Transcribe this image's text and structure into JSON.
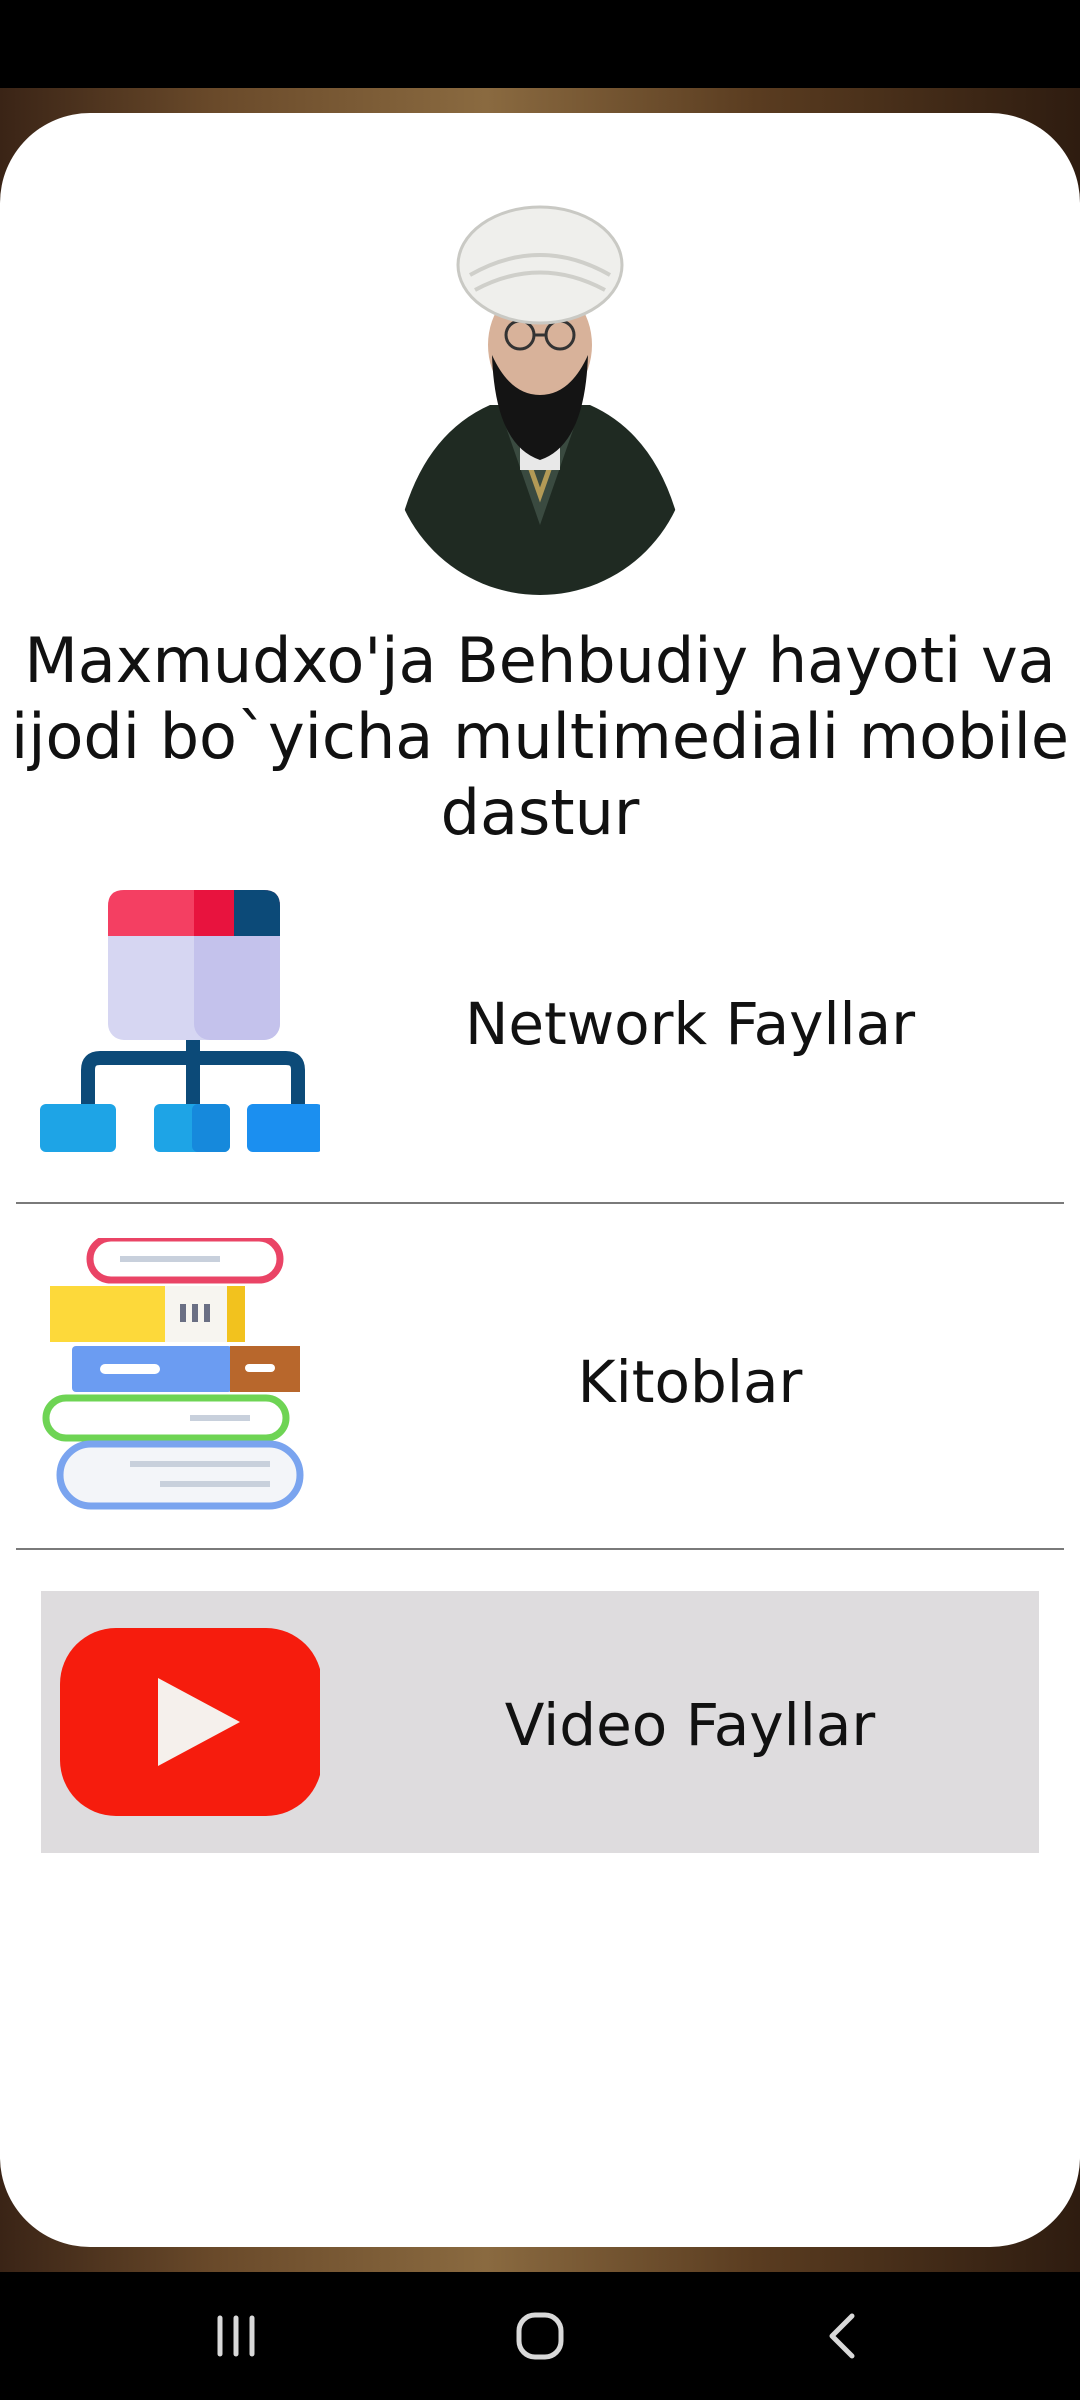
{
  "app": {
    "title": "Maxmudxo'ja Behbudiy hayoti va ijodi bo`yicha multimediali mobile dastur"
  },
  "portrait": {
    "alt": "Maxmudxo'ja Behbudiy portrait"
  },
  "menu": {
    "items": [
      {
        "label": "Network Fayllar",
        "icon": "network-tree-icon"
      },
      {
        "label": "Kitoblar",
        "icon": "books-stack-icon"
      },
      {
        "label": "Video Fayllar",
        "icon": "youtube-play-icon",
        "selected": true
      }
    ]
  },
  "nav": {
    "recent": "recent-apps-icon",
    "home": "home-icon",
    "back": "back-icon"
  },
  "colors": {
    "card": "#ffffff",
    "selected_bg": "#dedcde",
    "video_red": "#f61c0d"
  }
}
